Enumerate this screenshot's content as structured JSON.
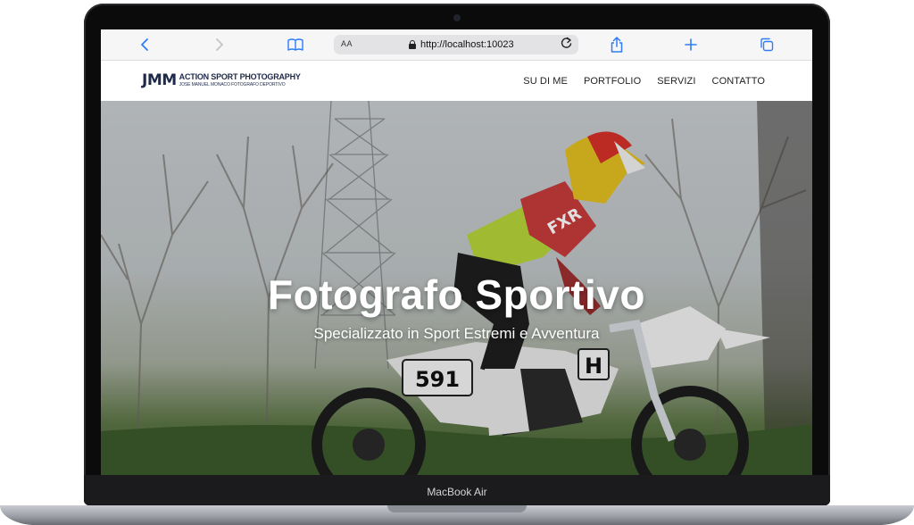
{
  "browser": {
    "back_icon": "chevron-left-icon",
    "forward_icon": "chevron-right-icon",
    "bookmarks_icon": "book-icon",
    "text_size_label": "AA",
    "url": "http://localhost:10023",
    "reload_icon": "reload-icon",
    "share_icon": "share-icon",
    "new_tab_icon": "plus-icon",
    "tabs_icon": "tabs-icon",
    "accent": "#2f7df6"
  },
  "site": {
    "logo_mark": "JMM",
    "logo_title": "ACTION SPORT PHOTOGRAPHY",
    "logo_subtitle": "JOSE MANUEL MONACO FOTOGRAFO DEPORTIVO",
    "brand_color": "#1f2a4a",
    "nav": [
      {
        "label": "SU DI ME"
      },
      {
        "label": "PORTFOLIO"
      },
      {
        "label": "SERVIZI"
      },
      {
        "label": "CONTATTO"
      }
    ]
  },
  "hero": {
    "title": "Fotografo Sportivo",
    "subtitle": "Specializzato in Sport Estremi e Avventura",
    "bike_number": "591",
    "bike_plate": "H",
    "jersey_text": "FXR"
  },
  "device": {
    "label": "MacBook Air"
  }
}
